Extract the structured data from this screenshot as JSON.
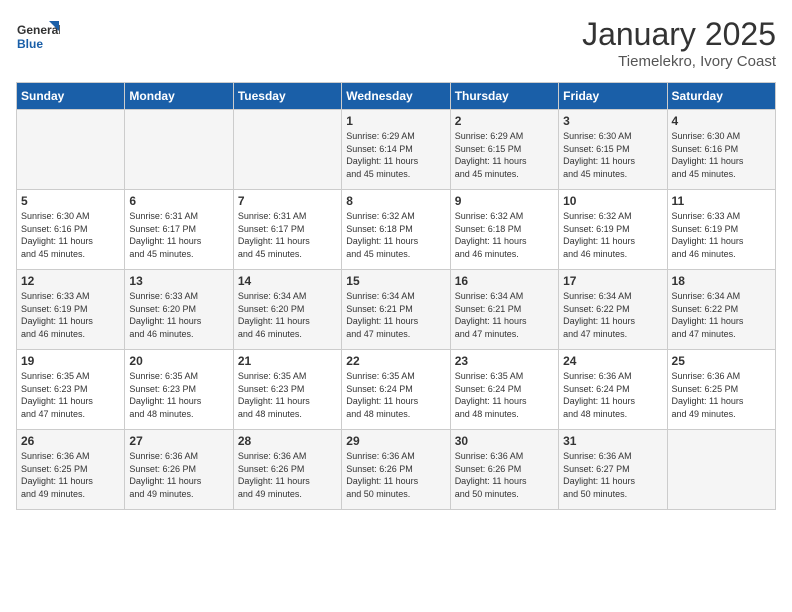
{
  "logo": {
    "line1": "General",
    "line2": "Blue"
  },
  "title": "January 2025",
  "subtitle": "Tiemelekro, Ivory Coast",
  "weekdays": [
    "Sunday",
    "Monday",
    "Tuesday",
    "Wednesday",
    "Thursday",
    "Friday",
    "Saturday"
  ],
  "weeks": [
    [
      {
        "day": "",
        "info": ""
      },
      {
        "day": "",
        "info": ""
      },
      {
        "day": "",
        "info": ""
      },
      {
        "day": "1",
        "info": "Sunrise: 6:29 AM\nSunset: 6:14 PM\nDaylight: 11 hours\nand 45 minutes."
      },
      {
        "day": "2",
        "info": "Sunrise: 6:29 AM\nSunset: 6:15 PM\nDaylight: 11 hours\nand 45 minutes."
      },
      {
        "day": "3",
        "info": "Sunrise: 6:30 AM\nSunset: 6:15 PM\nDaylight: 11 hours\nand 45 minutes."
      },
      {
        "day": "4",
        "info": "Sunrise: 6:30 AM\nSunset: 6:16 PM\nDaylight: 11 hours\nand 45 minutes."
      }
    ],
    [
      {
        "day": "5",
        "info": "Sunrise: 6:30 AM\nSunset: 6:16 PM\nDaylight: 11 hours\nand 45 minutes."
      },
      {
        "day": "6",
        "info": "Sunrise: 6:31 AM\nSunset: 6:17 PM\nDaylight: 11 hours\nand 45 minutes."
      },
      {
        "day": "7",
        "info": "Sunrise: 6:31 AM\nSunset: 6:17 PM\nDaylight: 11 hours\nand 45 minutes."
      },
      {
        "day": "8",
        "info": "Sunrise: 6:32 AM\nSunset: 6:18 PM\nDaylight: 11 hours\nand 45 minutes."
      },
      {
        "day": "9",
        "info": "Sunrise: 6:32 AM\nSunset: 6:18 PM\nDaylight: 11 hours\nand 46 minutes."
      },
      {
        "day": "10",
        "info": "Sunrise: 6:32 AM\nSunset: 6:19 PM\nDaylight: 11 hours\nand 46 minutes."
      },
      {
        "day": "11",
        "info": "Sunrise: 6:33 AM\nSunset: 6:19 PM\nDaylight: 11 hours\nand 46 minutes."
      }
    ],
    [
      {
        "day": "12",
        "info": "Sunrise: 6:33 AM\nSunset: 6:19 PM\nDaylight: 11 hours\nand 46 minutes."
      },
      {
        "day": "13",
        "info": "Sunrise: 6:33 AM\nSunset: 6:20 PM\nDaylight: 11 hours\nand 46 minutes."
      },
      {
        "day": "14",
        "info": "Sunrise: 6:34 AM\nSunset: 6:20 PM\nDaylight: 11 hours\nand 46 minutes."
      },
      {
        "day": "15",
        "info": "Sunrise: 6:34 AM\nSunset: 6:21 PM\nDaylight: 11 hours\nand 47 minutes."
      },
      {
        "day": "16",
        "info": "Sunrise: 6:34 AM\nSunset: 6:21 PM\nDaylight: 11 hours\nand 47 minutes."
      },
      {
        "day": "17",
        "info": "Sunrise: 6:34 AM\nSunset: 6:22 PM\nDaylight: 11 hours\nand 47 minutes."
      },
      {
        "day": "18",
        "info": "Sunrise: 6:34 AM\nSunset: 6:22 PM\nDaylight: 11 hours\nand 47 minutes."
      }
    ],
    [
      {
        "day": "19",
        "info": "Sunrise: 6:35 AM\nSunset: 6:23 PM\nDaylight: 11 hours\nand 47 minutes."
      },
      {
        "day": "20",
        "info": "Sunrise: 6:35 AM\nSunset: 6:23 PM\nDaylight: 11 hours\nand 48 minutes."
      },
      {
        "day": "21",
        "info": "Sunrise: 6:35 AM\nSunset: 6:23 PM\nDaylight: 11 hours\nand 48 minutes."
      },
      {
        "day": "22",
        "info": "Sunrise: 6:35 AM\nSunset: 6:24 PM\nDaylight: 11 hours\nand 48 minutes."
      },
      {
        "day": "23",
        "info": "Sunrise: 6:35 AM\nSunset: 6:24 PM\nDaylight: 11 hours\nand 48 minutes."
      },
      {
        "day": "24",
        "info": "Sunrise: 6:36 AM\nSunset: 6:24 PM\nDaylight: 11 hours\nand 48 minutes."
      },
      {
        "day": "25",
        "info": "Sunrise: 6:36 AM\nSunset: 6:25 PM\nDaylight: 11 hours\nand 49 minutes."
      }
    ],
    [
      {
        "day": "26",
        "info": "Sunrise: 6:36 AM\nSunset: 6:25 PM\nDaylight: 11 hours\nand 49 minutes."
      },
      {
        "day": "27",
        "info": "Sunrise: 6:36 AM\nSunset: 6:26 PM\nDaylight: 11 hours\nand 49 minutes."
      },
      {
        "day": "28",
        "info": "Sunrise: 6:36 AM\nSunset: 6:26 PM\nDaylight: 11 hours\nand 49 minutes."
      },
      {
        "day": "29",
        "info": "Sunrise: 6:36 AM\nSunset: 6:26 PM\nDaylight: 11 hours\nand 50 minutes."
      },
      {
        "day": "30",
        "info": "Sunrise: 6:36 AM\nSunset: 6:26 PM\nDaylight: 11 hours\nand 50 minutes."
      },
      {
        "day": "31",
        "info": "Sunrise: 6:36 AM\nSunset: 6:27 PM\nDaylight: 11 hours\nand 50 minutes."
      },
      {
        "day": "",
        "info": ""
      }
    ]
  ]
}
